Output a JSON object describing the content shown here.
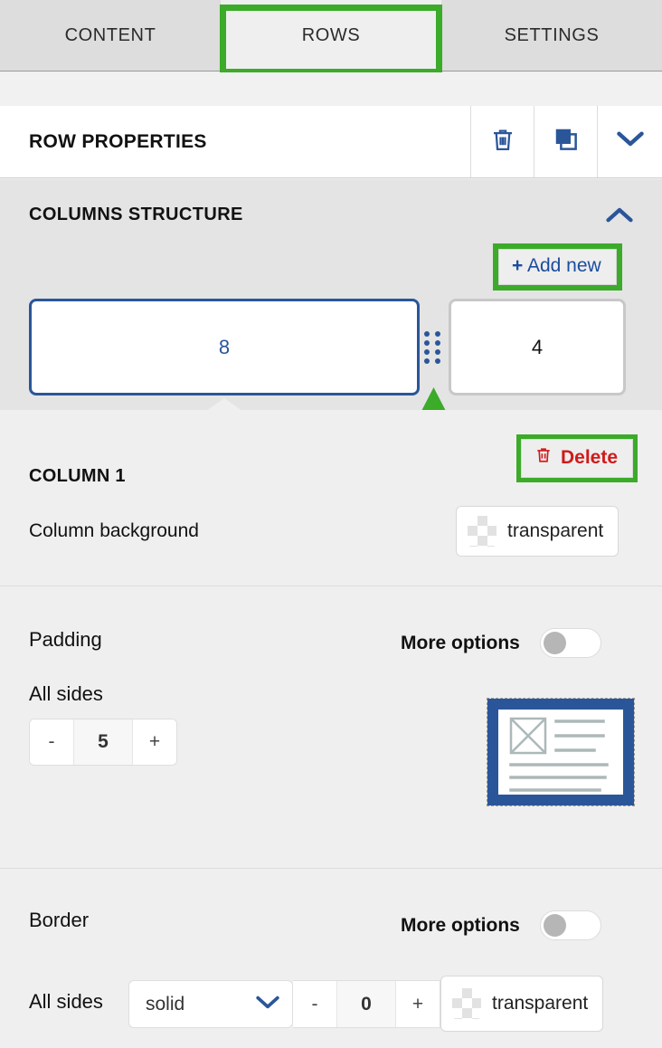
{
  "tabs": [
    {
      "label": "CONTENT",
      "active": false
    },
    {
      "label": "ROWS",
      "active": true
    },
    {
      "label": "SETTINGS",
      "active": false
    }
  ],
  "row_properties": {
    "title": "ROW PROPERTIES",
    "actions": [
      {
        "name": "delete-row",
        "icon": "trash-icon"
      },
      {
        "name": "duplicate-row",
        "icon": "duplicate-icon"
      },
      {
        "name": "collapse-row",
        "icon": "chevron-down-icon"
      }
    ]
  },
  "columns_structure": {
    "title": "COLUMNS STRUCTURE",
    "collapse_icon": "chevron-up-icon",
    "add_new_label": "Add new",
    "add_new_plus": "+",
    "columns": [
      {
        "value": "8",
        "selected": true
      },
      {
        "value": "4",
        "selected": false
      }
    ],
    "drag_handle_icon": "drag-dots-icon"
  },
  "column_panel": {
    "title": "COLUMN 1",
    "delete_label": "Delete",
    "delete_icon": "trash-icon",
    "background_label": "Column background",
    "background_value": "transparent"
  },
  "padding": {
    "title": "Padding",
    "more_options_label": "More options",
    "more_options_on": false,
    "all_sides_label": "All sides",
    "value": "5",
    "minus": "-",
    "plus": "+",
    "preview_icon": "padding-preview-icon"
  },
  "border": {
    "title": "Border",
    "more_options_label": "More options",
    "more_options_on": false,
    "all_sides_label": "All sides",
    "style": "solid",
    "style_chevron_icon": "chevron-down-icon",
    "width": "0",
    "minus": "-",
    "plus": "+",
    "color_value": "transparent"
  },
  "annotations": {
    "highlight_color": "#3bab29",
    "arrow_icon": "green-up-arrow",
    "highlighted": [
      "tab-rows",
      "add-new-button",
      "delete-column-button"
    ]
  },
  "colors": {
    "accent_blue": "#2a5699",
    "link_blue": "#1a4d9e",
    "danger_red": "#d11a1a",
    "highlight_green": "#3bab29",
    "panel_bg": "#efefef",
    "tab_bg": "#dddddd",
    "colstruct_bg": "#e4e4e4"
  }
}
